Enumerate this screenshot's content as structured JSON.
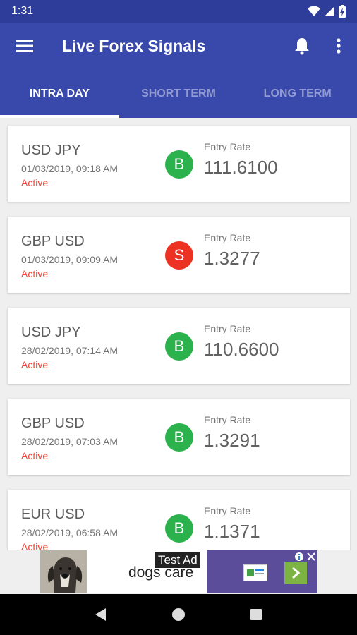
{
  "status_bar": {
    "time": "1:31"
  },
  "app_bar": {
    "title": "Live Forex Signals"
  },
  "tabs": [
    {
      "label": "INTRA DAY",
      "active": true
    },
    {
      "label": "SHORT TERM",
      "active": false
    },
    {
      "label": "LONG TERM",
      "active": false
    }
  ],
  "signals": [
    {
      "pair": "USD JPY",
      "datetime": "01/03/2019, 09:18 AM",
      "status": "Active",
      "action": "B",
      "rate_label": "Entry Rate",
      "rate": "111.6100"
    },
    {
      "pair": "GBP USD",
      "datetime": "01/03/2019, 09:09 AM",
      "status": "Active",
      "action": "S",
      "rate_label": "Entry Rate",
      "rate": "1.3277"
    },
    {
      "pair": "USD JPY",
      "datetime": "28/02/2019, 07:14 AM",
      "status": "Active",
      "action": "B",
      "rate_label": "Entry Rate",
      "rate": "110.6600"
    },
    {
      "pair": "GBP USD",
      "datetime": "28/02/2019, 07:03 AM",
      "status": "Active",
      "action": "B",
      "rate_label": "Entry Rate",
      "rate": "1.3291"
    },
    {
      "pair": "EUR USD",
      "datetime": "28/02/2019, 06:58 AM",
      "status": "Active",
      "action": "B",
      "rate_label": "Entry Rate",
      "rate": "1.1371"
    }
  ],
  "ad": {
    "label": "Test Ad",
    "text": "dogs care"
  },
  "colors": {
    "primary": "#3949ab",
    "status_bar": "#2e3d9a",
    "buy": "#2bb24c",
    "sell": "#ec3323",
    "active_status": "#f44336"
  },
  "icons": {
    "menu": "hamburger-icon",
    "notifications": "bell-icon",
    "overflow": "more-vert-icon",
    "back": "back-triangle-icon",
    "home": "home-circle-icon",
    "recents": "recents-square-icon"
  }
}
